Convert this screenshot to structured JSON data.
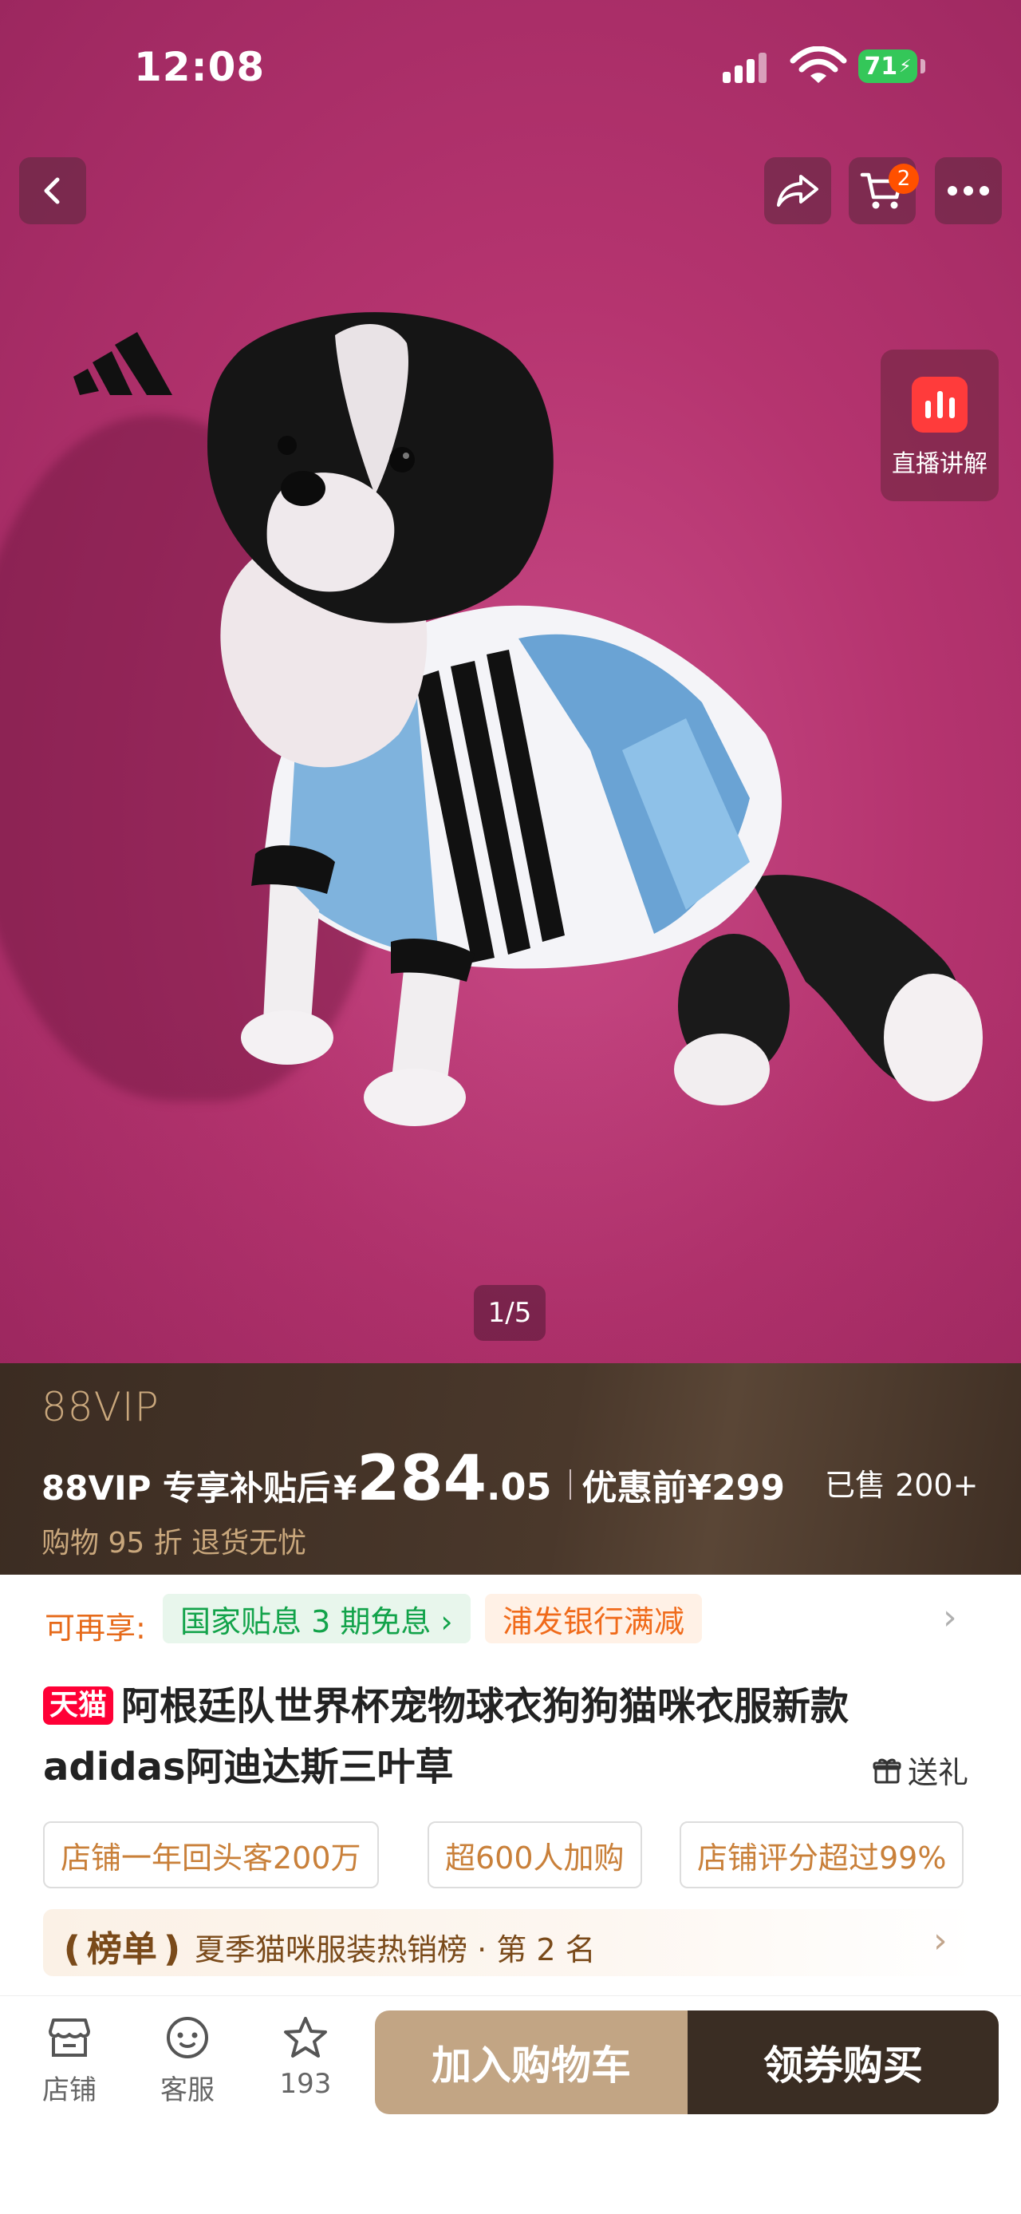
{
  "status_bar": {
    "time": "12:08",
    "battery": "71"
  },
  "nav": {
    "cart_count": "2"
  },
  "live_button": {
    "label": "直播讲解"
  },
  "gallery": {
    "counter": "1/5"
  },
  "vip": {
    "logo": "88VIP",
    "price_prefix": "88VIP 专享补贴后",
    "currency": "¥",
    "price_int": "284",
    "price_dec": ".05",
    "original_label": "优惠前¥299",
    "sold": "已售 200+",
    "sub": "购物 95 折  退货无忧"
  },
  "promo": {
    "label": "可再享:",
    "tag_green": "国家贴息 3 期免息 ›",
    "tag_orange": "浦发银行满减"
  },
  "product": {
    "badge": "天猫",
    "title": "阿根廷队世界杯宠物球衣狗狗猫咪衣服新款adidas阿迪达斯三叶草",
    "gift_label": "送礼"
  },
  "chips": [
    "店铺一年回头客200万",
    "超600人加购",
    "店铺评分超过99%"
  ],
  "rank": {
    "logo": "榜单",
    "text": "夏季猫咪服装热销榜 · 第 2 名"
  },
  "bottom": {
    "shop": "店铺",
    "service": "客服",
    "fav_count": "193",
    "add_cart": "加入购物车",
    "buy": "领券购买"
  },
  "colors": {
    "vip_gold": "#c9a77c",
    "tmall_red": "#ff0036",
    "promo_orange": "#e66a1a",
    "promo_green": "#12a34a",
    "cart_button": "#c2a584",
    "buy_button": "#3a2d23"
  }
}
